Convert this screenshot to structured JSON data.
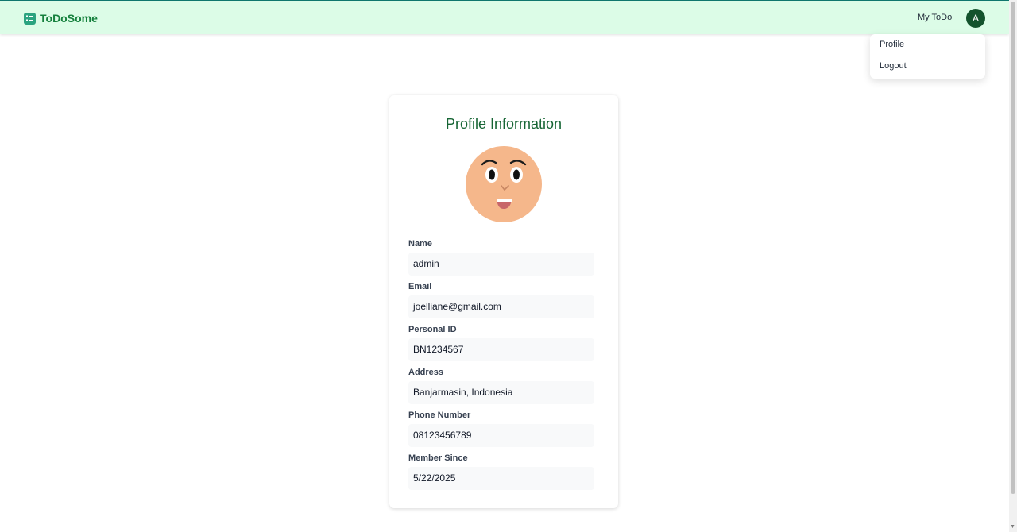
{
  "header": {
    "brand_name": "ToDoSome",
    "brand_icon": "checklist-icon",
    "nav_link": "My ToDo",
    "avatar_initial": "A"
  },
  "dropdown": {
    "items": [
      {
        "label": "Profile"
      },
      {
        "label": "Logout"
      }
    ]
  },
  "profile": {
    "title": "Profile Information",
    "avatar_icon": "cartoon-face-avatar",
    "fields": [
      {
        "label": "Name",
        "value": "admin"
      },
      {
        "label": "Email",
        "value": "joelliane@gmail.com"
      },
      {
        "label": "Personal ID",
        "value": "BN1234567"
      },
      {
        "label": "Address",
        "value": "Banjarmasin, Indonesia"
      },
      {
        "label": "Phone Number",
        "value": "08123456789"
      },
      {
        "label": "Member Since",
        "value": "5/22/2025"
      }
    ]
  },
  "colors": {
    "header_bg": "#dcfce7",
    "brand": "#15803d",
    "avatar_bg": "#14532d",
    "title": "#166534",
    "field_bg": "#f8f9fa",
    "face": "#f5b78b"
  }
}
